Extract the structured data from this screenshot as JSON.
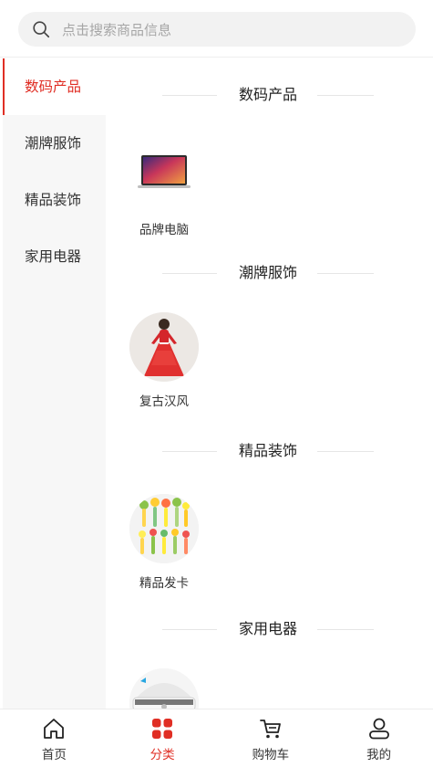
{
  "search": {
    "placeholder": "点击搜索商品信息",
    "icon": "search-icon"
  },
  "sidebar": {
    "items": [
      {
        "label": "数码产品",
        "active": true
      },
      {
        "label": "潮牌服饰",
        "active": false
      },
      {
        "label": "精品装饰",
        "active": false
      },
      {
        "label": "家用电器",
        "active": false
      }
    ]
  },
  "sections": [
    {
      "title": "数码产品",
      "items": [
        {
          "label": "品牌电脑",
          "icon": "laptop-image"
        }
      ]
    },
    {
      "title": "潮牌服饰",
      "items": [
        {
          "label": "复古汉风",
          "icon": "hanfu-dress-image"
        }
      ]
    },
    {
      "title": "精品装饰",
      "items": [
        {
          "label": "精品发卡",
          "icon": "hair-clips-image"
        }
      ]
    },
    {
      "title": "家用电器",
      "items": [
        {
          "label": "",
          "icon": "appliance-image"
        }
      ]
    }
  ],
  "tabbar": {
    "items": [
      {
        "label": "首页",
        "icon": "home-icon",
        "active": false
      },
      {
        "label": "分类",
        "icon": "category-icon",
        "active": true
      },
      {
        "label": "购物车",
        "icon": "cart-icon",
        "active": false
      },
      {
        "label": "我的",
        "icon": "user-icon",
        "active": false
      }
    ]
  },
  "colors": {
    "accent": "#e02e24",
    "sidebar_bg": "#f7f7f7",
    "search_bg": "#f2f2f2"
  }
}
